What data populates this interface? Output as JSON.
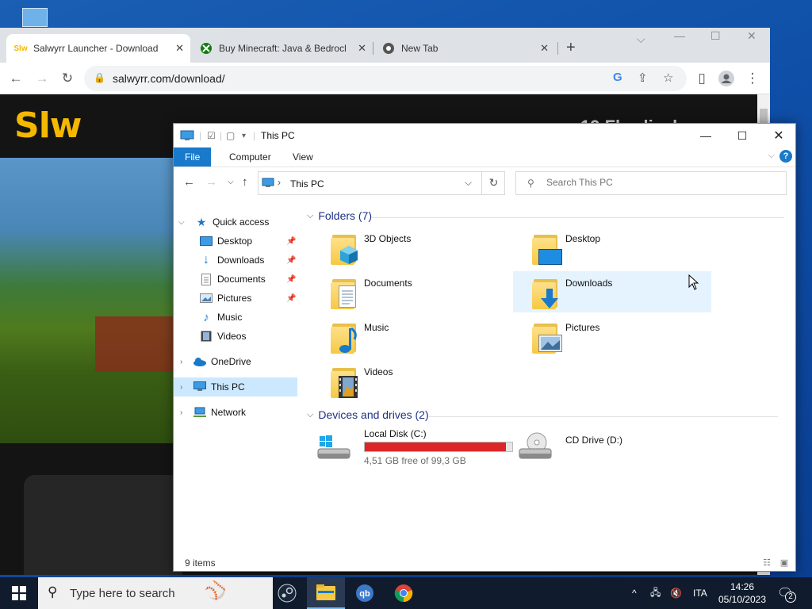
{
  "browser": {
    "tabs": [
      {
        "title": "Salwyrr Launcher - Download",
        "favicon": "Slw",
        "active": true
      },
      {
        "title": "Buy Minecraft: Java & Bedrock",
        "favicon": "xbox-icon",
        "active": false
      },
      {
        "title": "New Tab",
        "favicon": "chrome-icon",
        "active": false
      }
    ],
    "url": "salwyrr.com/download/",
    "page": {
      "logo": "Slw",
      "heading": "19 Flurdi... k"
    }
  },
  "explorer": {
    "title": "This PC",
    "ribbon_tabs": [
      "File",
      "Computer",
      "View"
    ],
    "address": "This PC",
    "search_placeholder": "Search This PC",
    "nav": {
      "quick_access": "Quick access",
      "quick_items": [
        "Desktop",
        "Downloads",
        "Documents",
        "Pictures",
        "Music",
        "Videos"
      ],
      "onedrive": "OneDrive",
      "this_pc": "This PC",
      "network": "Network"
    },
    "folders_header": "Folders (7)",
    "folders": [
      {
        "name": "3D Objects",
        "icon": "3d-objects-icon"
      },
      {
        "name": "Desktop",
        "icon": "desktop-icon"
      },
      {
        "name": "Documents",
        "icon": "documents-icon"
      },
      {
        "name": "Downloads",
        "icon": "downloads-icon"
      },
      {
        "name": "Music",
        "icon": "music-icon"
      },
      {
        "name": "Pictures",
        "icon": "pictures-icon"
      },
      {
        "name": "Videos",
        "icon": "videos-icon"
      }
    ],
    "drives_header": "Devices and drives (2)",
    "drives": [
      {
        "name": "Local Disk (C:)",
        "free_text": "4,51 GB free of 99,3 GB",
        "used_fraction": 0.955,
        "bar_color": "#da2626"
      },
      {
        "name": "CD Drive (D:)"
      }
    ],
    "status": "9 items"
  },
  "taskbar": {
    "search_text": "Type here to search",
    "language": "ITA",
    "time": "14:26",
    "date": "05/10/2023",
    "notifications": "2"
  },
  "colors": {
    "accent": "#1979ca",
    "selection": "#cce8ff",
    "hover": "#e5f3ff",
    "logo": "#f5b800"
  }
}
